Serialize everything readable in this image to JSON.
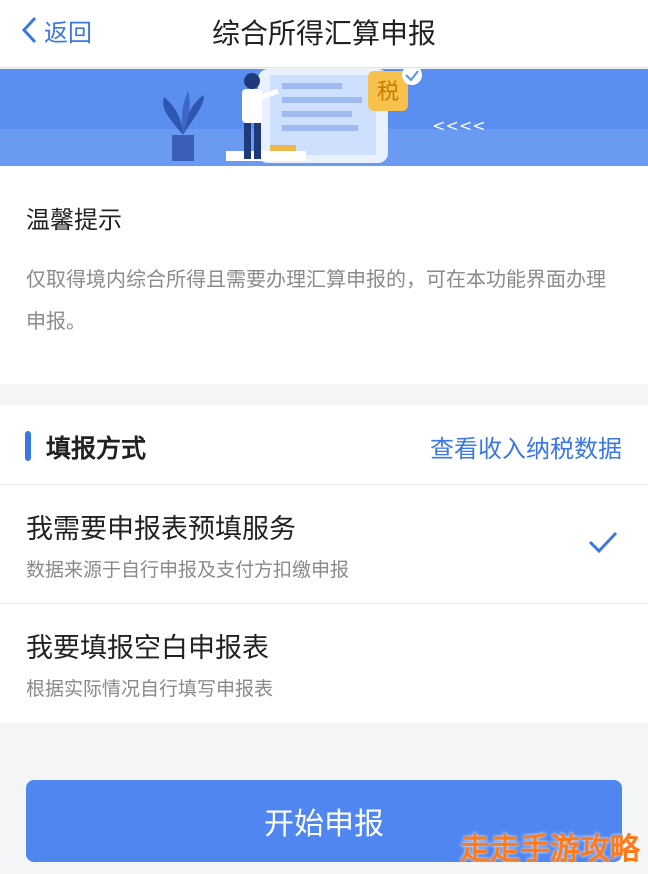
{
  "nav": {
    "back_label": "返回",
    "title": "综合所得汇算申报"
  },
  "banner": {
    "badge": "税",
    "arrows": "<<<<"
  },
  "tip": {
    "title": "温馨提示",
    "text": "仅取得境内综合所得且需要办理汇算申报的，可在本功能界面办理申报。"
  },
  "method": {
    "title": "填报方式",
    "link": "查看收入纳税数据",
    "options": [
      {
        "title": "我需要申报表预填服务",
        "subtitle": "数据来源于自行申报及支付方扣缴申报",
        "selected": true
      },
      {
        "title": "我要填报空白申报表",
        "subtitle": "根据实际情况自行填写申报表",
        "selected": false
      }
    ]
  },
  "start_button": "开始申报",
  "watermark": "走走手游攻略",
  "colors": {
    "accent": "#3b78e7",
    "banner": "#5a8ef0",
    "button": "#4f86f0"
  }
}
